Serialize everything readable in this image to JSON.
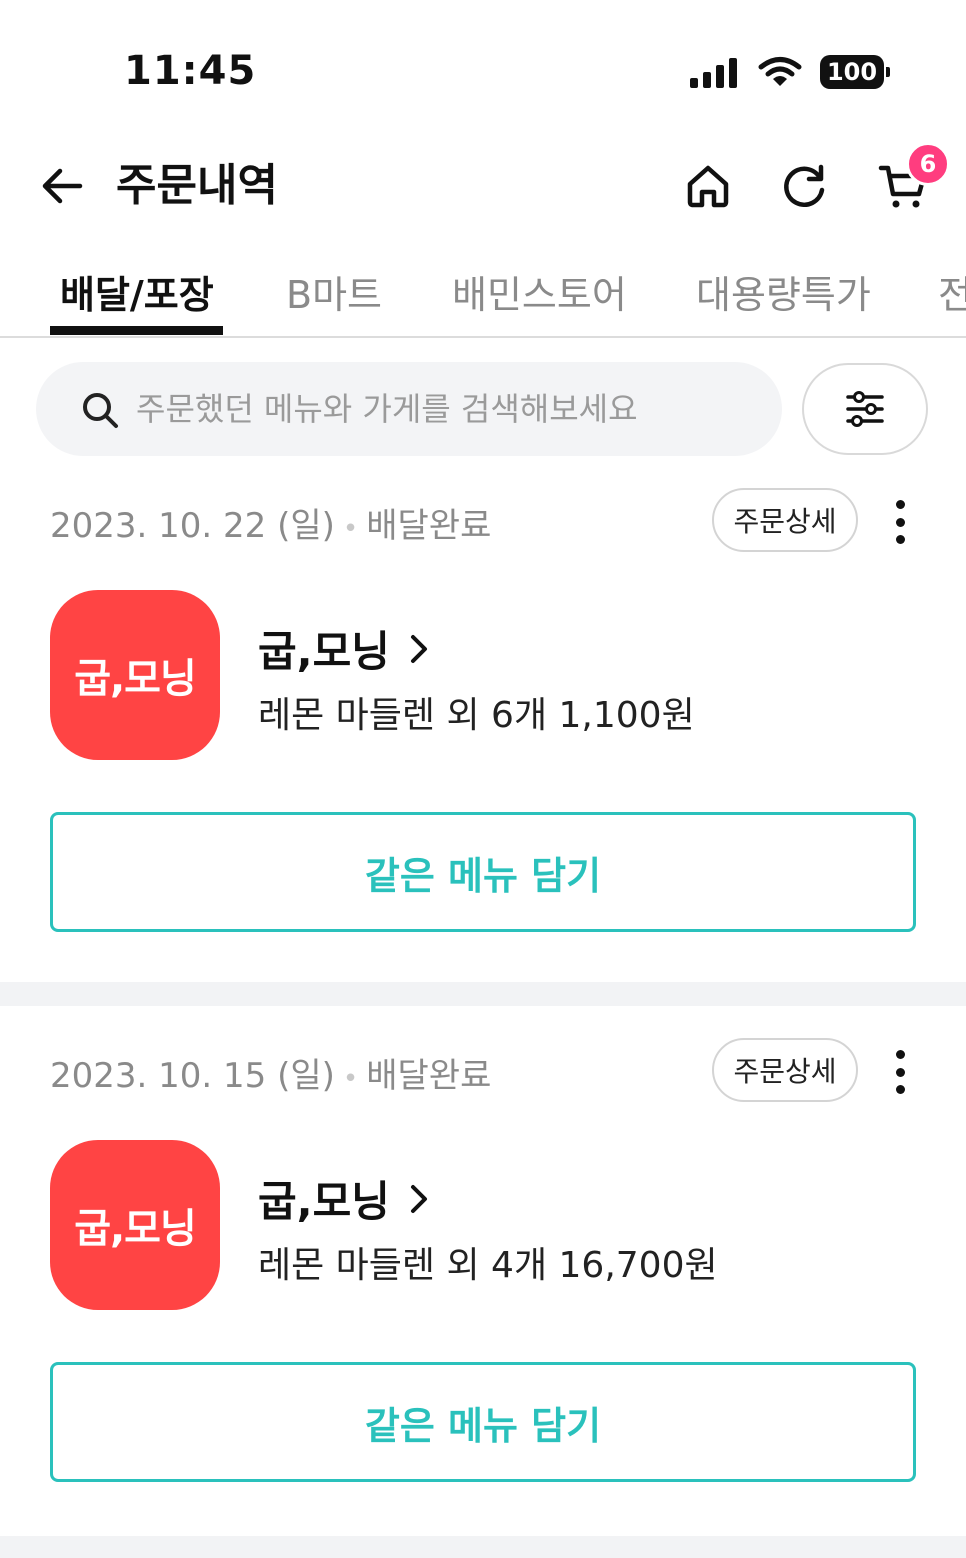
{
  "status_bar": {
    "time": "11:45",
    "battery": "100"
  },
  "header": {
    "title": "주문내역",
    "cart_count": "6"
  },
  "tabs": [
    {
      "label": "배달/포장",
      "active": true
    },
    {
      "label": "B마트",
      "active": false
    },
    {
      "label": "배민스토어",
      "active": false
    },
    {
      "label": "대용량특가",
      "active": false
    },
    {
      "label": "전",
      "active": false
    }
  ],
  "search": {
    "placeholder": "주문했던 메뉴와 가게를 검색해보세요"
  },
  "orders": [
    {
      "date": "2023. 10. 22 (일)",
      "status": "배달완료",
      "detail_label": "주문상세",
      "store_logo_text": "굽,모닝",
      "store_name": "굽,모닝",
      "summary": "레몬 마들렌 외 6개 1,100원",
      "reorder_label": "같은 메뉴 담기"
    },
    {
      "date": "2023. 10. 15 (일)",
      "status": "배달완료",
      "detail_label": "주문상세",
      "store_logo_text": "굽,모닝",
      "store_name": "굽,모닝",
      "summary": "레몬 마들렌 외 4개 16,700원",
      "reorder_label": "같은 메뉴 담기"
    }
  ],
  "colors": {
    "accent": "#2ac1bc",
    "badge": "#ff3d7f",
    "store_logo": "#ff4444"
  }
}
